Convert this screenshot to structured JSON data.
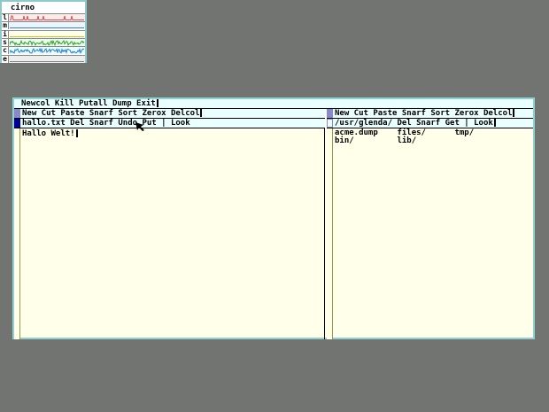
{
  "stats": {
    "host": "cirno",
    "rows": [
      {
        "label": "l",
        "color": "#d05050",
        "bg": "#ffeaea"
      },
      {
        "label": "m",
        "color": "#4a7fb0",
        "bg": "#eaf6ff"
      },
      {
        "label": "i",
        "color": "#c0c040",
        "bg": "#ffffea"
      },
      {
        "label": "s",
        "color": "#3a9a3a",
        "bg": "#eaffea"
      },
      {
        "label": "c",
        "color": "#2a7fd0",
        "bg": "#eaffff"
      },
      {
        "label": "e",
        "color": "#888888",
        "bg": "#eeeeee"
      }
    ]
  },
  "acme": {
    "main_tag": "Newcol Kill Putall Dump Exit",
    "columns": [
      {
        "tag": "New Cut Paste Snarf Sort Zerox Delcol",
        "windows": [
          {
            "tag": "hallo.txt Del Snarf Undo Put | Look",
            "body": "Hallo Welt!"
          }
        ]
      },
      {
        "tag": "New Cut Paste Snarf Sort Zerox Delcol",
        "windows": [
          {
            "tag": "/usr/glenda/ Del Snarf Get | Look",
            "body": "acme.dump    files/      tmp/\nbin/         lib/"
          }
        ]
      }
    ]
  },
  "colors": {
    "background": "#727471",
    "tag": "#eaffff",
    "body": "#ffffea",
    "border": "#8fd0d0",
    "modified_box": "#000099",
    "box": "#8888cc"
  }
}
